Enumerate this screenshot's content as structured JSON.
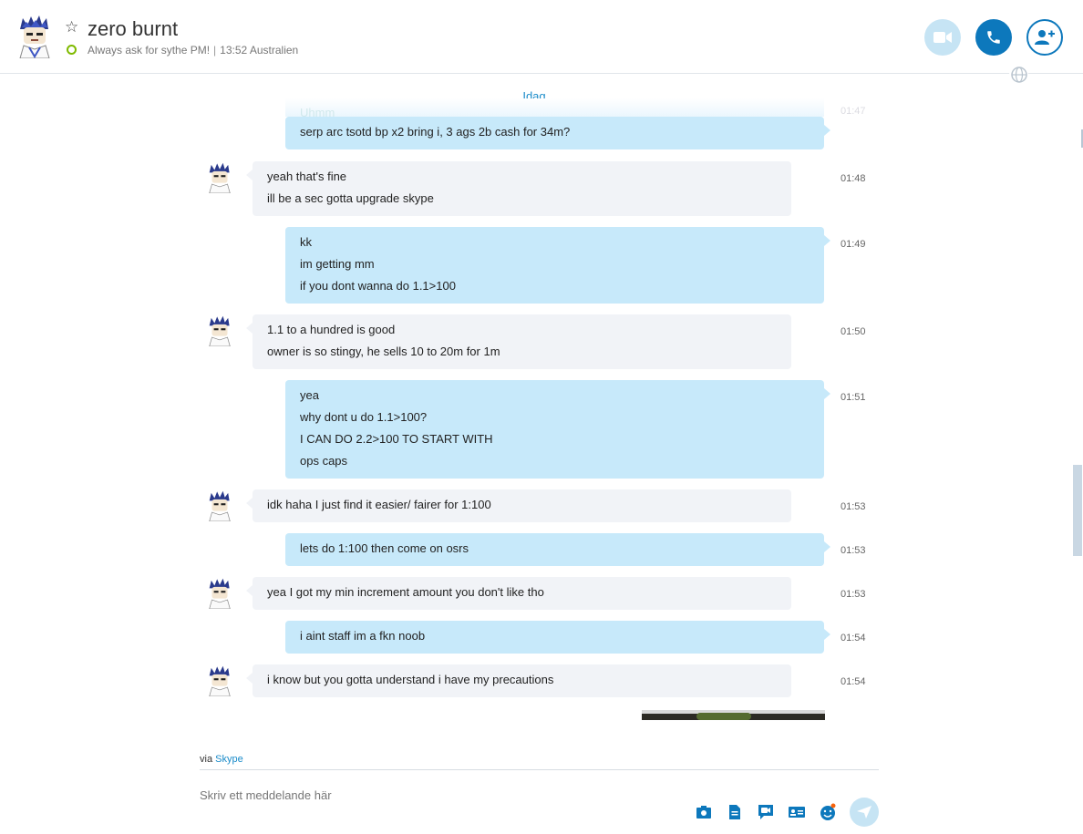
{
  "header": {
    "contact_name": "zero burnt",
    "mood": "Always ask for sythe PM!",
    "local_time": "13:52 Australien",
    "separator": "|"
  },
  "chat": {
    "day_label": "Idag",
    "faded_message": {
      "text": "Uhmm",
      "time": "01:47"
    },
    "messages": [
      {
        "side": "out",
        "lines": [
          "serp arc tsotd bp x2 bring i, 3 ags 2b cash for 34m?"
        ],
        "time": ""
      },
      {
        "side": "in",
        "lines": [
          "yeah that's fine",
          "ill be a sec gotta upgrade skype"
        ],
        "time": "01:48"
      },
      {
        "side": "out",
        "lines": [
          "kk",
          "im getting mm",
          "if you dont wanna do 1.1>100"
        ],
        "time": "01:49"
      },
      {
        "side": "in",
        "lines": [
          "1.1 to a hundred is good",
          "owner is so stingy, he sells 10 to 20m for 1m"
        ],
        "time": "01:50"
      },
      {
        "side": "out",
        "lines": [
          "yea",
          "why dont u do 1.1>100?",
          "I CAN DO 2.2>100 TO START WITH",
          "ops caps"
        ],
        "time": "01:51"
      },
      {
        "side": "in",
        "lines": [
          "idk haha I just find it easier/ fairer for 1:100"
        ],
        "time": "01:53"
      },
      {
        "side": "out",
        "lines": [
          "lets do 1:100 then come on osrs"
        ],
        "time": "01:53"
      },
      {
        "side": "in",
        "lines": [
          "yea I got my min increment amount you don't like tho"
        ],
        "time": "01:53"
      },
      {
        "side": "out",
        "lines": [
          "i aint staff im a fkn noob"
        ],
        "time": "01:54"
      },
      {
        "side": "in",
        "lines": [
          "i know but you gotta understand i have my precautions"
        ],
        "time": "01:54"
      }
    ]
  },
  "composer": {
    "via_prefix": "via",
    "via_link": "Skype",
    "placeholder": "Skriv ett meddelande här"
  },
  "colors": {
    "accent": "#0d78bc",
    "outgoing_bubble": "#c7e9fa",
    "incoming_bubble": "#f1f3f7",
    "presence_online": "#7fba00"
  },
  "icons": {
    "video": "video-camera-icon",
    "call": "phone-icon",
    "add_people": "add-person-icon",
    "globe": "globe-icon",
    "tools": [
      "media-icon",
      "file-icon",
      "video-message-icon",
      "contact-card-icon",
      "emoticon-icon",
      "send-icon"
    ]
  }
}
